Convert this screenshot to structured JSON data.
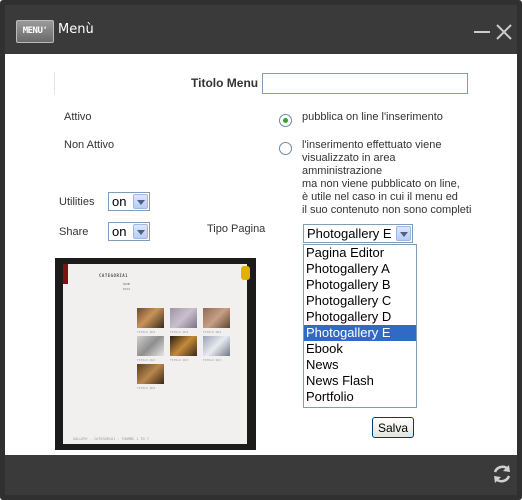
{
  "window": {
    "badge": "MENU'",
    "title": "Menù",
    "minimize_icon": "minimize-icon",
    "close_icon": "close-icon",
    "refresh_icon": "refresh-icon"
  },
  "form": {
    "titolo_label": "Titolo Menu",
    "titolo_value": "",
    "attivo_label": "Attivo",
    "attivo_desc": "pubblica on line l'inserimento",
    "non_attivo_label": "Non Attivo",
    "non_attivo_desc": [
      "l'inserimento effettuato viene",
      "visualizzato in area",
      "amministrazione",
      "ma non viene pubblicato on line,",
      "è utile nel caso in cui il menu ed",
      "il suo contenuto non sono completi"
    ],
    "utilities_label": "Utilities",
    "utilities_value": "on",
    "share_label": "Share",
    "share_value": "on",
    "tipo_label": "Tipo Pagina",
    "tipo_value": "Photogallery E",
    "tipo_options": [
      "Pagina Editor",
      "Photogallery A",
      "Photogallery B",
      "Photogallery C",
      "Photogallery D",
      "Photogallery E",
      "Ebook",
      "News",
      "News Flash",
      "Portfolio"
    ],
    "selected_index": 5,
    "save_label": "Salva"
  },
  "preview": {
    "title": "CATEGORIA1",
    "subtitle_1": "NAME",
    "subtitle_2": "DATA",
    "caption": "TITOLO QUI",
    "footer": "GALLERY - CATEGORIA1 - THUMBS 1 TO 7"
  }
}
